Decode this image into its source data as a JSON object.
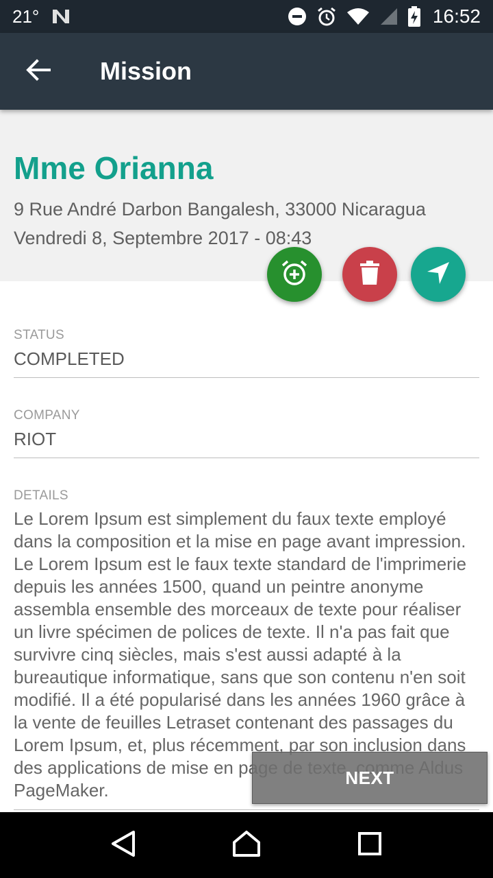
{
  "status_bar": {
    "temperature": "21°",
    "time": "16:52",
    "icons": [
      "notification-n-icon",
      "do-not-disturb-icon",
      "alarm-clock-icon",
      "wifi-icon",
      "signal-icon",
      "battery-charging-icon"
    ]
  },
  "app_bar": {
    "title": "Mission",
    "back_icon": "arrow-left-icon"
  },
  "header": {
    "name": "Mme Orianna",
    "address": "9 Rue André Darbon Bangalesh, 33000 Nicaragua",
    "datetime": "Vendredi 8, Septembre 2017 - 08:43"
  },
  "actions": [
    {
      "name": "add-alarm",
      "icon": "alarm-add-icon",
      "color": "#27902e"
    },
    {
      "name": "delete",
      "icon": "trash-icon",
      "color": "#c9404a"
    },
    {
      "name": "navigate",
      "icon": "navigation-arrow-icon",
      "color": "#17a78f"
    }
  ],
  "fields": {
    "status": {
      "label": "STATUS",
      "value": "COMPLETED"
    },
    "company": {
      "label": "COMPANY",
      "value": "RIOT"
    },
    "details": {
      "label": "DETAILS",
      "value": "Le Lorem Ipsum est simplement du faux texte employé dans la composition et la mise en page avant impression. Le Lorem Ipsum est le faux texte standard de l'imprimerie depuis les années 1500, quand un peintre anonyme assembla ensemble des morceaux de texte pour réaliser un livre spécimen de polices de texte. Il n'a pas fait que survivre cinq siècles, mais s'est aussi adapté à la bureautique informatique, sans que son contenu n'en soit modifié. Il a été popularisé dans les années 1960 grâce à la vente de feuilles Letraset contenant des passages du Lorem Ipsum, et, plus récemment, par son inclusion dans des applications de mise en page de texte, comme Aldus PageMaker."
    }
  },
  "next_button": {
    "label": "NEXT"
  },
  "nav_bar": {
    "icons": [
      "back-triangle-icon",
      "home-icon",
      "recents-icon"
    ]
  },
  "colors": {
    "status_bar": "#1e2730",
    "app_bar": "#2c3843",
    "accent": "#13a08c",
    "header_bg": "#f1f1f1"
  }
}
